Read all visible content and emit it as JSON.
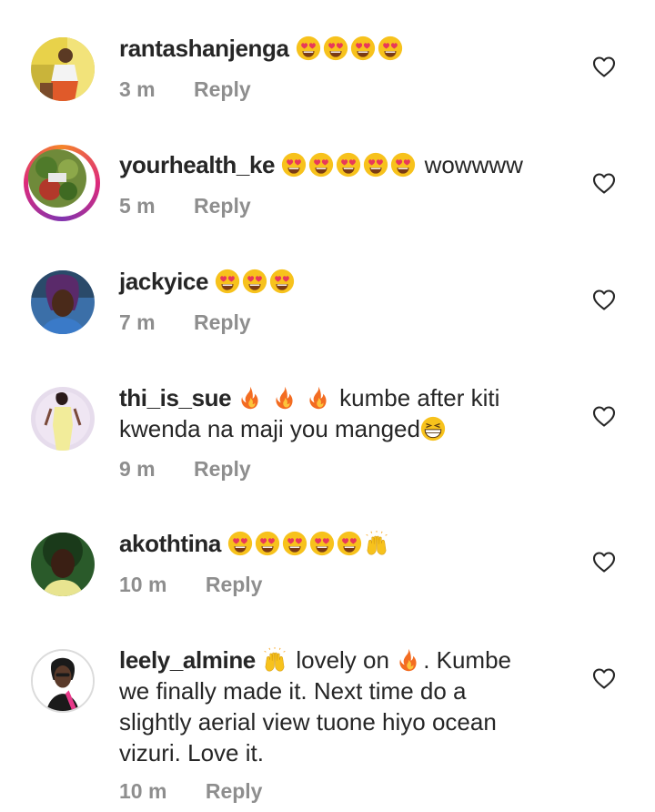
{
  "comments": [
    {
      "username": "rantashanjenga",
      "emojis": [
        "heart-eyes",
        "heart-eyes",
        "heart-eyes",
        "heart-eyes"
      ],
      "text": "",
      "time": "3 m",
      "reply": "Reply"
    },
    {
      "username": "yourhealth_ke",
      "emojis": [
        "heart-eyes",
        "heart-eyes",
        "heart-eyes",
        "heart-eyes",
        "heart-eyes"
      ],
      "text": "wowwww",
      "time": "5 m",
      "reply": "Reply"
    },
    {
      "username": "jackyice",
      "emojis": [
        "heart-eyes",
        "heart-eyes",
        "heart-eyes"
      ],
      "text": "",
      "time": "7 m",
      "reply": "Reply"
    },
    {
      "username": "thi_is_sue",
      "emojis": [
        "fire",
        "fire",
        "fire"
      ],
      "text_line1": "kumbe after kiti",
      "text_line2": "kwenda na maji you manged",
      "trailing_emoji": "grin-squint",
      "time": "9 m",
      "reply": "Reply"
    },
    {
      "username": "akothtina",
      "emojis": [
        "heart-eyes",
        "heart-eyes",
        "heart-eyes",
        "heart-eyes",
        "heart-eyes",
        "raised-hands"
      ],
      "text": "",
      "time": "10 m",
      "reply": "Reply"
    },
    {
      "username": "leely_almine",
      "text_part1": "lovely on",
      "text_part2": ". Kumbe",
      "line2": "we finally made it. Next time do a",
      "line3": "slightly aerial view tuone hiyo ocean",
      "line4": "vizuri. Love it.",
      "time": "10 m",
      "reply": "Reply"
    }
  ],
  "colors": {
    "text": "#262626",
    "meta": "#8e8e8e",
    "emoji_face": "#f7c21c",
    "emoji_heart": "#e8385a",
    "fire": "#f36c21"
  },
  "icons": {
    "like": "heart-outline-icon"
  }
}
